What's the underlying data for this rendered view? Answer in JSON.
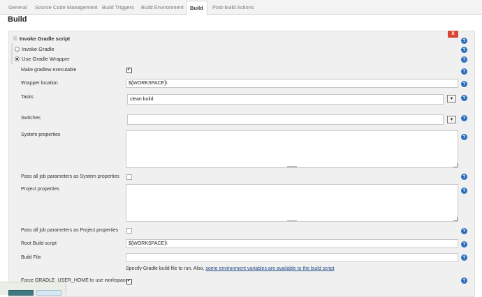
{
  "tabs": [
    "General",
    "Source Code Management",
    "Build Triggers",
    "Build Environment",
    "Build",
    "Post-build Actions"
  ],
  "page_title": "Build",
  "step": {
    "title": "Invoke Gradle script",
    "delete_label": "X",
    "help_glyph": "?",
    "invoke_gradle": "Invoke Gradle",
    "use_wrapper": "Use Gradle Wrapper"
  },
  "fields": {
    "make_executable": "Make gradlew executable",
    "wrapper_location": "Wrapper location",
    "wrapper_location_value": "${WORKSPACE}\\",
    "tasks": "Tasks",
    "tasks_value": "clean build",
    "switches": "Switches",
    "switches_value": "",
    "system_properties": "System properties",
    "pass_system": "Pass all job parameters as System properties",
    "project_properties": "Project properties",
    "pass_project": "Pass all job parameters as Project properties",
    "root_build_script": "Root Build script",
    "root_build_script_value": "${WORKSPACE}\\",
    "build_file": "Build File",
    "build_file_value": "",
    "force_home": "Force GRADLE_USER_HOME to use workspace"
  },
  "dropdown_glyph": "▼",
  "help_text": {
    "prefix": "Specify Gradle build file to run. Also, ",
    "link": "some environment variables are available to the build script"
  },
  "colors": {
    "accent": "#2a6ebb",
    "delete": "#d64632",
    "panel": "#f0f0f0"
  }
}
